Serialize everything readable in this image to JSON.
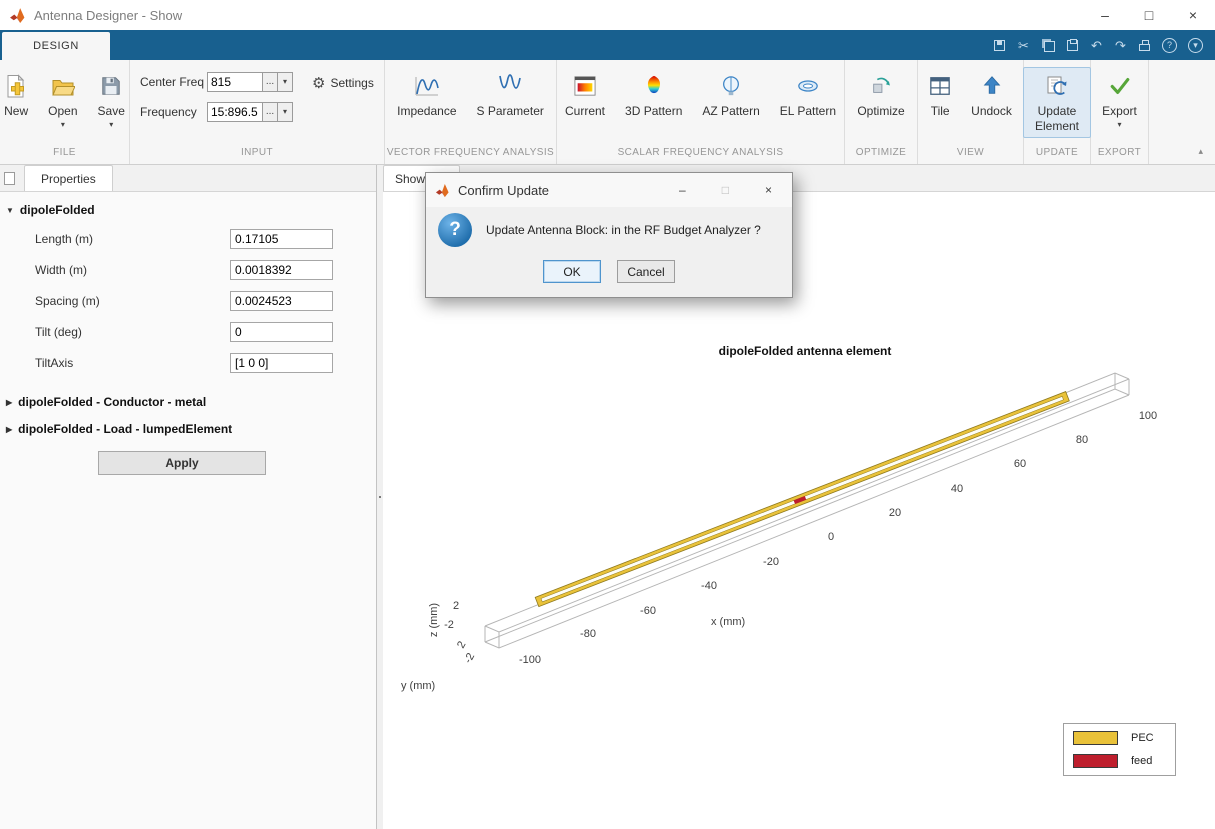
{
  "window": {
    "title": "Antenna Designer - Show"
  },
  "titlebar_controls": {
    "minimize": "–",
    "maximize": "□",
    "close": "×"
  },
  "ribbon": {
    "design_tab": "DESIGN"
  },
  "icons": {
    "dropdown": "▾",
    "expanded": "▼",
    "collapsed": "▶",
    "gear": "⚙",
    "strip_collapse": "▴",
    "question": "?",
    "cut": "✂",
    "undo": "↶",
    "redo": "↷",
    "help": "?"
  },
  "toolstrip": {
    "file": {
      "section": "FILE",
      "new": "New",
      "open": "Open",
      "save": "Save"
    },
    "input": {
      "section": "INPUT",
      "center_freq_label": "Center Freq",
      "center_freq_value": "815",
      "frequency_label": "Frequency",
      "frequency_value": "15:896.5",
      "browse": "...",
      "settings": "Settings"
    },
    "vector": {
      "section": "VECTOR FREQUENCY ANALYSIS",
      "impedance": "Impedance",
      "s_parameter": "S Parameter"
    },
    "scalar": {
      "section": "SCALAR FREQUENCY ANALYSIS",
      "current": "Current",
      "pattern_3d": "3D Pattern",
      "az_pattern": "AZ Pattern",
      "el_pattern": "EL Pattern"
    },
    "optimize": {
      "section": "OPTIMIZE",
      "optimize": "Optimize"
    },
    "view": {
      "section": "VIEW",
      "tile": "Tile",
      "undock": "Undock"
    },
    "update": {
      "section": "UPDATE",
      "update_element": "Update Element"
    },
    "export": {
      "section": "EXPORT",
      "export": "Export"
    }
  },
  "properties_panel": {
    "tab": "Properties",
    "group_main": "dipoleFolded",
    "rows": [
      {
        "label": "Length (m)",
        "value": "0.17105"
      },
      {
        "label": "Width (m)",
        "value": "0.0018392"
      },
      {
        "label": "Spacing (m)",
        "value": "0.0024523"
      },
      {
        "label": "Tilt (deg)",
        "value": "0"
      },
      {
        "label": "TiltAxis",
        "value": "[1 0 0]"
      }
    ],
    "group_conductor": "dipoleFolded - Conductor - metal",
    "group_load": "dipoleFolded - Load - lumpedElement",
    "apply": "Apply"
  },
  "canvas": {
    "tab": "Show",
    "plot": {
      "title": "dipoleFolded antenna element",
      "xlabel": "x (mm)",
      "ylabel": "y (mm)",
      "zlabel": "z (mm)",
      "xticks": [
        "-100",
        "-80",
        "-60",
        "-40",
        "-20",
        "0",
        "20",
        "40",
        "60",
        "80",
        "100"
      ],
      "zticks": [
        "2",
        "-2"
      ],
      "yticks": [
        "2",
        "-2"
      ],
      "legend": [
        {
          "label": "PEC",
          "color": "#E9C23A"
        },
        {
          "label": "feed",
          "color": "#BE1E2D"
        }
      ]
    }
  },
  "dialog": {
    "title": "Confirm Update",
    "message": "Update Antenna Block: in the RF Budget Analyzer ?",
    "ok": "OK",
    "cancel": "Cancel"
  }
}
